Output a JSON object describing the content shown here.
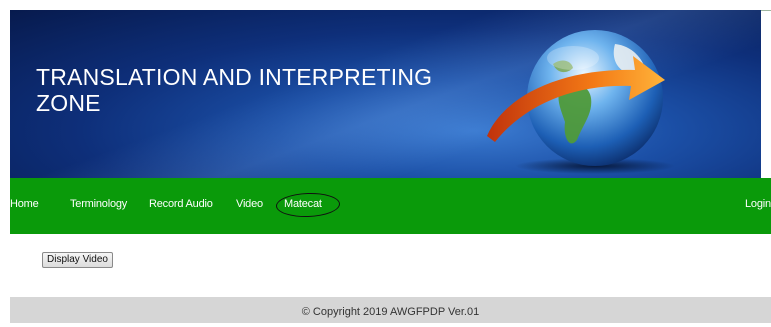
{
  "banner": {
    "title": "TRANSLATION AND INTERPRETING\nZONE",
    "graphic": "globe-with-orange-arrow"
  },
  "nav": {
    "items": [
      {
        "label": "Home"
      },
      {
        "label": "Terminology"
      },
      {
        "label": "Record Audio"
      },
      {
        "label": "Video"
      },
      {
        "label": "Matecat"
      }
    ],
    "login_label": "Login",
    "background": "#0a9a0a"
  },
  "content": {
    "display_video_label": "Display Video"
  },
  "footer": {
    "copyright": "© Copyright 2019 AWGFPDP Ver.01"
  }
}
